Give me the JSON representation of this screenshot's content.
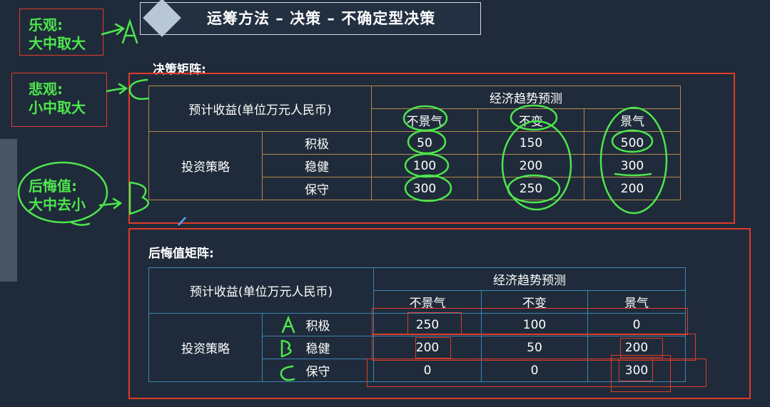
{
  "slide": {
    "title": "运筹方法 – 决策 – 不确定型决策",
    "section1_title": "决策矩阵:",
    "section2_title": "后悔值矩阵:"
  },
  "notes": {
    "optimistic_label": "乐观:",
    "optimistic_rule": "大中取大",
    "optimistic_choice": "A",
    "pessimistic_label": "悲观:",
    "pessimistic_rule": "小中取大",
    "pessimistic_choice": "C",
    "regret_label": "后悔值:",
    "regret_rule": "大中去小",
    "regret_choice": "B"
  },
  "decision_matrix": {
    "corner_header": "预计收益(单位万元人民币)",
    "group_header": "经济趋势预测",
    "columns": [
      "不景气",
      "不变",
      "景气"
    ],
    "row_group": "投资策略",
    "rows": [
      {
        "label": "积极",
        "values": [
          "50",
          "150",
          "500"
        ]
      },
      {
        "label": "稳健",
        "values": [
          "100",
          "200",
          "300"
        ]
      },
      {
        "label": "保守",
        "values": [
          "300",
          "250",
          "200"
        ]
      }
    ]
  },
  "regret_matrix": {
    "corner_header": "预计收益(单位万元人民币)",
    "group_header": "经济趋势预测",
    "columns": [
      "不景气",
      "不变",
      "景气"
    ],
    "row_group": "投资策略",
    "row_marks": [
      "A",
      "B",
      "C"
    ],
    "rows": [
      {
        "label": "积极",
        "values": [
          "250",
          "100",
          "0"
        ]
      },
      {
        "label": "稳健",
        "values": [
          "200",
          "50",
          "200"
        ]
      },
      {
        "label": "保守",
        "values": [
          "0",
          "0",
          "300"
        ]
      }
    ]
  },
  "colors": {
    "background": "#1f2b3a",
    "annotation_red": "#e03a2a",
    "annotation_green": "#4de64d",
    "table1_border": "#b8894c",
    "table2_border": "#3b86b4"
  }
}
